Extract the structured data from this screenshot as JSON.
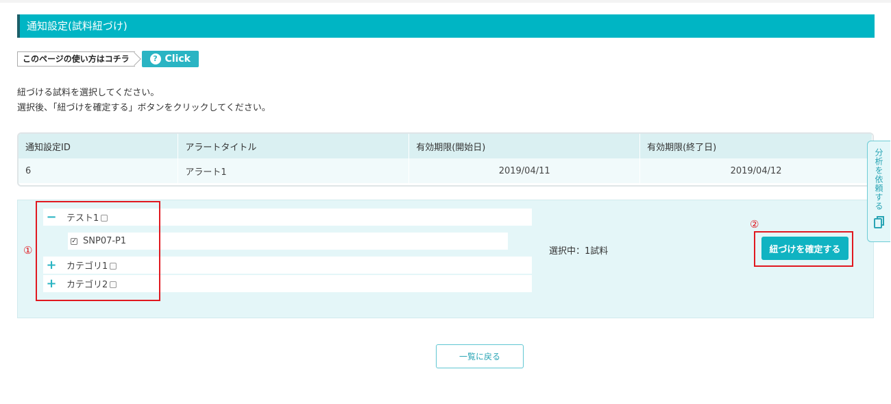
{
  "page": {
    "title": "通知設定(試料紐づけ)",
    "help_label": "このページの使い方はコチラ",
    "help_button": "Click",
    "help_icon": "question-icon"
  },
  "instructions": [
    "紐づける試料を選択してください。",
    "選択後、「紐づけを確定する」ボタンをクリックしてください。"
  ],
  "table": {
    "headers": [
      "通知設定ID",
      "アラートタイトル",
      "有効期限(開始日)",
      "有効期限(終了日)"
    ],
    "rows": [
      [
        "6",
        "アラート1",
        "2019/04/11",
        "2019/04/12"
      ]
    ]
  },
  "tree": {
    "nodes": [
      {
        "label": "テスト1",
        "toggle": "−",
        "checked": false
      },
      {
        "label": "SNP07-P1",
        "checked": true
      },
      {
        "label": "カテゴリ1",
        "toggle": "+",
        "checked": false
      },
      {
        "label": "カテゴリ2",
        "toggle": "+",
        "checked": false
      }
    ]
  },
  "selection": {
    "count_text": "選択中：1試料"
  },
  "confirm_button": "紐づけを確定する",
  "annotations": {
    "one": "①",
    "two": "②"
  },
  "back_button": "一覧に戻る",
  "side_tab": {
    "label": "分析を依頼する",
    "icon": "copy-icon"
  },
  "colors": {
    "accent": "#00b5c4",
    "highlight": "#e0181f",
    "panel": "#e4f6f8"
  }
}
